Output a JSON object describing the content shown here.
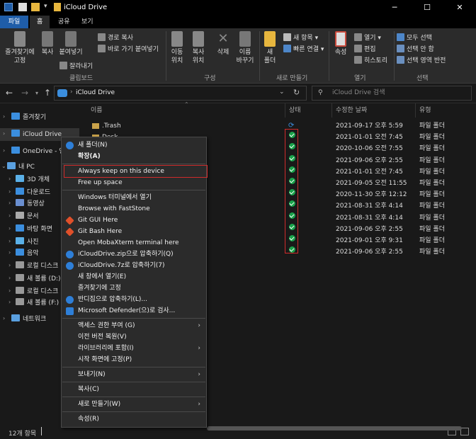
{
  "window": {
    "title": "iCloud Drive",
    "minimize_glyph": "─",
    "maximize_glyph": "☐",
    "close_glyph": "✕"
  },
  "tabs": [
    "파일",
    "홈",
    "공유",
    "보기"
  ],
  "ribbon": {
    "clipboard": {
      "pin": "즐겨찾기에\n고정",
      "copy": "복사",
      "paste": "붙여넣기",
      "cut": "잘라내기",
      "copy_path": "경로 복사",
      "paste_shortcut": "바로 가기 붙여넣기",
      "label": "클립보드"
    },
    "organize": {
      "move_to": "이동\n위치",
      "copy_to": "복사\n위치",
      "delete": "삭제",
      "rename": "이름\n바꾸기",
      "label": "구성"
    },
    "new": {
      "new_folder": "새\n폴더",
      "new_item": "새 항목",
      "easy_access": "빠른 연결",
      "label": "새로 만들기"
    },
    "open": {
      "properties": "속성",
      "open": "열기",
      "edit": "편집",
      "history": "히스토리",
      "label": "열기"
    },
    "select": {
      "select_all": "모두 선택",
      "select_none": "선택 안 함",
      "invert": "선택 영역 반전",
      "label": "선택"
    }
  },
  "address": {
    "path": "iCloud Drive",
    "search_placeholder": "iCloud Drive 검색"
  },
  "sidebar": {
    "items": [
      {
        "label": "즐겨찾기",
        "icon": "star-icon"
      },
      {
        "label": "iCloud Drive",
        "icon": "icloud-icon"
      },
      {
        "label": "OneDrive - 연",
        "icon": "onedrive-icon"
      },
      {
        "label": "내 PC",
        "icon": "pc-icon"
      },
      {
        "label": "3D 개체",
        "icon": "3d-icon"
      },
      {
        "label": "다운로드",
        "icon": "download-icon"
      },
      {
        "label": "동영상",
        "icon": "video-icon"
      },
      {
        "label": "문서",
        "icon": "document-icon"
      },
      {
        "label": "바탕 화면",
        "icon": "desktop-icon"
      },
      {
        "label": "사진",
        "icon": "picture-icon"
      },
      {
        "label": "음악",
        "icon": "music-icon"
      },
      {
        "label": "로컬 디스크",
        "icon": "disk-icon"
      },
      {
        "label": "새 볼륨 (D:)",
        "icon": "disk-icon"
      },
      {
        "label": "로컬 디스크",
        "icon": "disk-icon"
      },
      {
        "label": "새 볼륨 (F:)",
        "icon": "disk-icon"
      },
      {
        "label": "네트워크",
        "icon": "network-icon"
      }
    ]
  },
  "columns": {
    "name": "이름",
    "status": "상태",
    "modified": "수정한 날짜",
    "type": "유형"
  },
  "files": [
    {
      "name": ".Trash",
      "date": "2021-09-17 오후 5:59",
      "type": "파일 폴더",
      "status": "sync"
    },
    {
      "name": "Desk",
      "date": "2021-01-01 오전 7:45",
      "type": "파일 폴더",
      "status": "ok"
    },
    {
      "name": "",
      "date": "2020-10-06 오전 7:55",
      "type": "파일 폴더",
      "status": "ok"
    },
    {
      "name": "",
      "date": "2021-09-06 오후 2:55",
      "type": "파일 폴더",
      "status": "ok"
    },
    {
      "name": "",
      "date": "2021-01-01 오전 7:45",
      "type": "파일 폴더",
      "status": "ok"
    },
    {
      "name": "",
      "date": "2021-09-05 오전 11:55",
      "type": "파일 폴더",
      "status": "ok"
    },
    {
      "name": "",
      "date": "2020-11-30 오후 12:12",
      "type": "파일 폴더",
      "status": "ok"
    },
    {
      "name": "",
      "date": "2021-08-31 오후 4:14",
      "type": "파일 폴더",
      "status": "ok"
    },
    {
      "name": "",
      "date": "2021-08-31 오후 4:14",
      "type": "파일 폴더",
      "status": "ok"
    },
    {
      "name": "",
      "date": "2021-09-06 오후 2:55",
      "type": "파일 폴더",
      "status": "ok"
    },
    {
      "name": "",
      "date": "2021-09-01 오후 9:31",
      "type": "파일 폴더",
      "status": "ok"
    },
    {
      "name": "",
      "date": "2021-09-06 오후 2:55",
      "type": "파일 폴더",
      "status": "ok"
    }
  ],
  "context_menu": [
    {
      "label": "새 폴더(N)",
      "icon": "icloud-blue-icon"
    },
    {
      "label": "확장(A)",
      "bold": true
    },
    {
      "sep": true
    },
    {
      "label": "Always keep on this device",
      "highlight": true
    },
    {
      "label": "Free up space"
    },
    {
      "sep": true
    },
    {
      "label": "Windows 터미널에서 열기"
    },
    {
      "label": "Browse with FastStone"
    },
    {
      "label": "Git GUI Here",
      "icon": "git-icon"
    },
    {
      "label": "Git Bash Here",
      "icon": "git-icon"
    },
    {
      "label": "Open MobaXterm terminal here"
    },
    {
      "label": "iCloudDrive.zip으로 압축하기(Q)",
      "icon": "bandizip-icon"
    },
    {
      "label": "iCloudDrive.7z로 압축하기(7)",
      "icon": "bandizip-icon"
    },
    {
      "label": "새 창에서 열기(E)"
    },
    {
      "label": "즐겨찾기에 고정"
    },
    {
      "label": "반디집으로 압축하기(L)...",
      "icon": "bandizip-icon"
    },
    {
      "label": "Microsoft Defender(으)로 검사...",
      "icon": "defender-icon"
    },
    {
      "sep": true
    },
    {
      "label": "액세스 권한 부여 (G)",
      "submenu": true
    },
    {
      "label": "이전 버전 복원(V)"
    },
    {
      "label": "라이브러리에 포함(I)",
      "submenu": true
    },
    {
      "label": "시작 화면에 고정(P)"
    },
    {
      "sep": true
    },
    {
      "label": "보내기(N)",
      "submenu": true
    },
    {
      "sep": true
    },
    {
      "label": "복사(C)"
    },
    {
      "sep": true
    },
    {
      "label": "새로 만들기(W)",
      "submenu": true
    },
    {
      "sep": true
    },
    {
      "label": "속성(R)"
    }
  ],
  "status_bar": {
    "count": "12개 항목"
  }
}
